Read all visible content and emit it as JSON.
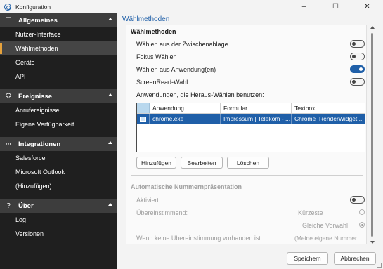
{
  "window": {
    "title": "Konfiguration",
    "controls": {
      "minimize": "–",
      "maximize": "☐",
      "close": "✕"
    }
  },
  "sidebar": {
    "sections": [
      {
        "icon": "hamburger-icon",
        "icon_glyph": "☰",
        "label": "Allgemeines",
        "items": [
          "Nutzer-Interface",
          "Wählmethoden",
          "Geräte",
          "API"
        ],
        "selected": 1
      },
      {
        "icon": "headset-icon",
        "icon_glyph": "☊",
        "label": "Ereignisse",
        "items": [
          "Anrufereignisse",
          "Eigene Verfügbarkeit"
        ]
      },
      {
        "icon": "link-icon",
        "icon_glyph": "∞",
        "label": "Integrationen",
        "items": [
          "Salesforce",
          "Microsoft Outlook",
          "(Hinzufügen)"
        ]
      },
      {
        "icon": "question-icon",
        "icon_glyph": "?",
        "label": "Über",
        "items": [
          "Log",
          "Versionen"
        ]
      }
    ]
  },
  "main": {
    "page_title": "Wählmethoden",
    "group1": {
      "title": "Wählmethoden",
      "options": [
        {
          "label": "Wählen aus der Zwischenablage",
          "enabled": false
        },
        {
          "label": "Fokus Wählen",
          "enabled": false
        },
        {
          "label": "Wählen aus Anwendung(en)",
          "enabled": true
        },
        {
          "label": "ScreenRead-Wahl",
          "enabled": false
        }
      ],
      "apps_label": "Anwendungen, die Heraus-Wählen benutzen:",
      "table": {
        "columns": [
          "",
          "Anwendung",
          "Formular",
          "Textbox"
        ],
        "rows": [
          {
            "app": "chrome.exe",
            "form": "Impressum | Telekom - ...",
            "textbox": "Chrome_RenderWidget..."
          }
        ]
      },
      "buttons": {
        "add": "Hinzufügen",
        "edit": "Bearbeiten",
        "delete": "Löschen"
      }
    },
    "group2": {
      "title": "Automatische Nummernpräsentation",
      "active_label": "Aktiviert",
      "active_enabled": false,
      "match_label": "Übereinstimmend:",
      "match_options": [
        {
          "label": "Kürzeste",
          "checked": false
        },
        {
          "label": "Gleiche Vorwahl",
          "checked": true
        }
      ],
      "no_match_label": "Wenn keine Übereinstimmung vorhanden ist",
      "no_match_value": "(Meine eigene Nummer"
    },
    "footer": {
      "save": "Speichern",
      "cancel": "Abbrechen"
    }
  },
  "colors": {
    "accent": "#1f5fa8",
    "sidebar_bg": "#1f1f1f",
    "section_bg": "#3d3d3d",
    "selected_marker": "#e6a23c"
  }
}
